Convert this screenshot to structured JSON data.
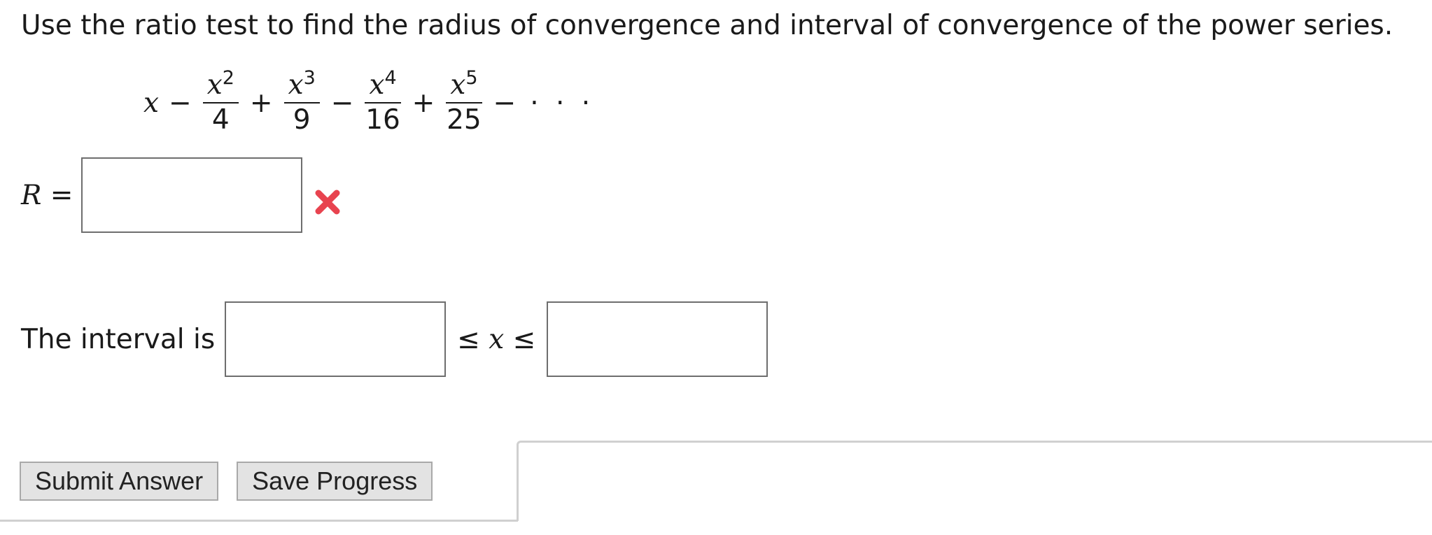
{
  "question": {
    "text": "Use the ratio test to find the radius of convergence and interval of convergence of the power series."
  },
  "series": {
    "first_term": "x",
    "terms": [
      {
        "op": "−",
        "num_base": "x",
        "num_exp": "2",
        "den": "4"
      },
      {
        "op": "+",
        "num_base": "x",
        "num_exp": "3",
        "den": "9"
      },
      {
        "op": "−",
        "num_base": "x",
        "num_exp": "4",
        "den": "16"
      },
      {
        "op": "+",
        "num_base": "x",
        "num_exp": "5",
        "den": "25"
      }
    ],
    "trailing_op": "−",
    "ellipsis": "· · ·"
  },
  "radius": {
    "label_var": "R",
    "label_eq": " =",
    "value": "",
    "status_icon": "x-mark-icon",
    "status_color": "#e8434f"
  },
  "interval": {
    "label": "The interval is",
    "lower_value": "",
    "middle_left": "≤ ",
    "middle_var": "x",
    "middle_right": " ≤",
    "upper_value": ""
  },
  "actions": {
    "submit_label": "Submit Answer",
    "save_label": "Save Progress"
  }
}
